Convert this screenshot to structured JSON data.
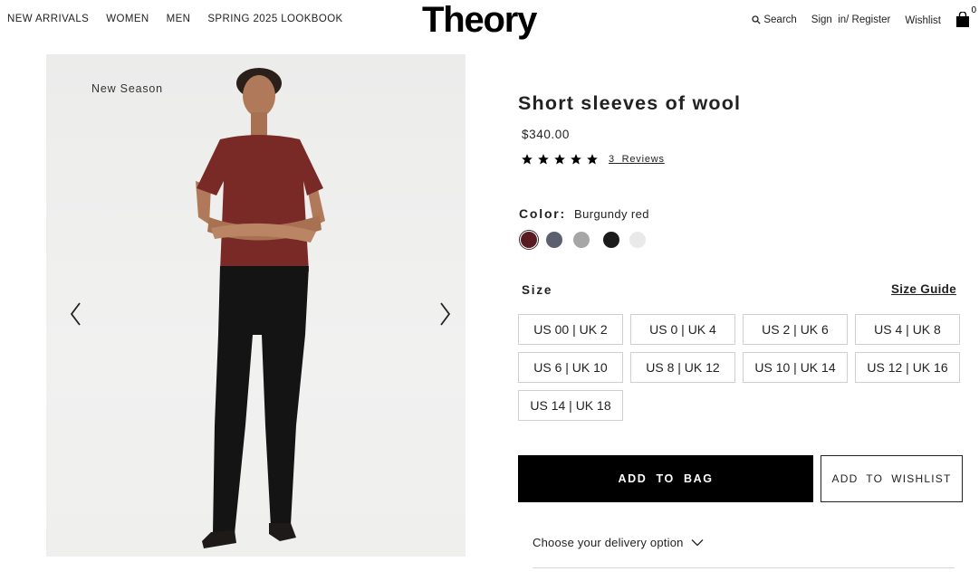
{
  "header": {
    "nav": [
      "NEW ARRIVALS",
      "WOMEN",
      "MEN",
      "SPRING 2025 LOOKBOOK"
    ],
    "logo": "Theory",
    "search_label": "Search",
    "signin_label": "Sign  in/ Register",
    "wishlist_label": "Wishlist",
    "bag_count": "0"
  },
  "gallery": {
    "badge": "New Season",
    "prev_icon": "chevron-left-icon",
    "next_icon": "chevron-right-icon"
  },
  "product": {
    "title": "Short sleeves of wool",
    "price": "$340.00",
    "rating": 5,
    "reviews_label": "3  Reviews",
    "color_label": "Color:",
    "color_value": "Burgundy red",
    "swatches": [
      {
        "name": "Burgundy red",
        "hex": "#5a1a22",
        "selected": true
      },
      {
        "name": "Slate",
        "hex": "#5c5f6e",
        "selected": false
      },
      {
        "name": "Grey",
        "hex": "#a6a6a6",
        "selected": false
      },
      {
        "name": "Black",
        "hex": "#1b1b1b",
        "selected": false
      },
      {
        "name": "White",
        "hex": "#e9e9e9",
        "selected": false
      }
    ],
    "size_label": "Size",
    "size_guide_label": "Size Guide",
    "sizes": [
      "US 00 | UK 2",
      "US 0 | UK 4",
      "US 2 | UK 6",
      "US 4 | UK 8",
      "US 6 | UK 10",
      "US 8 | UK 12",
      "US 10 | UK 14",
      "US 12 | UK 16",
      "US 14 | UK 18"
    ],
    "add_to_bag_label": "ADD  TO  BAG",
    "add_to_wishlist_label": "ADD  TO  WISHLIST",
    "delivery_label": "Choose your delivery option"
  },
  "colors": {
    "primary_button": "#000000",
    "shirt": "#7a2a26",
    "pants": "#141414"
  }
}
